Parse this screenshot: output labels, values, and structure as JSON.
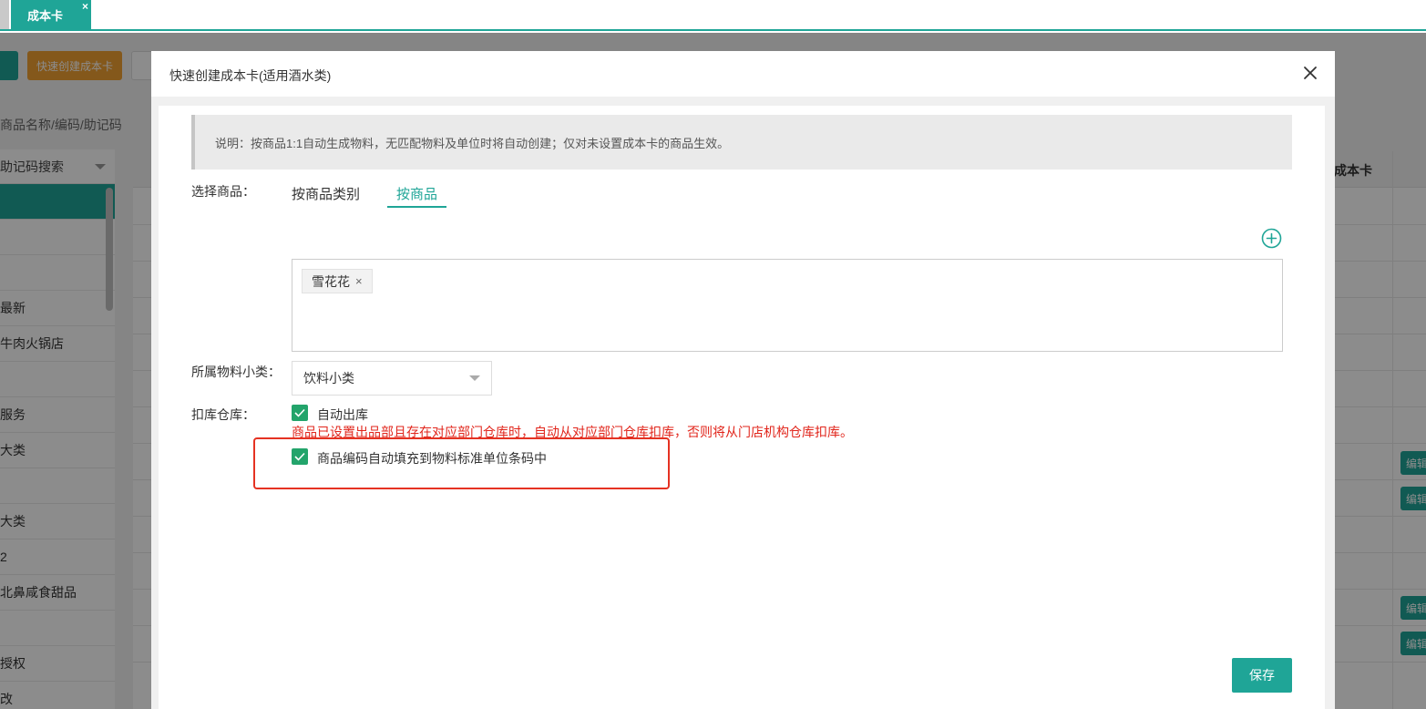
{
  "tabs": {
    "active_label": "成本卡",
    "close_glyph": "×"
  },
  "background": {
    "toolbar": {
      "quick_create_label": "快速创建成本卡"
    },
    "search_placeholder": "商品名称/编码/助记码",
    "sidebar_select": "助记码搜索",
    "sidebar_items": [
      "",
      "",
      "",
      "最新",
      "牛肉火锅店",
      "",
      "服务",
      "大类",
      "",
      "大类",
      "2",
      "北鼻咸食甜品",
      "",
      "授权",
      "改"
    ],
    "table": {
      "header_cost_card": "成本卡",
      "edit_label": "编辑"
    }
  },
  "modal": {
    "title": "快速创建成本卡(适用酒水类)",
    "close_icon": "close-icon",
    "notice": "说明：按商品1:1自动生成物料，无匹配物料及单位时将自动创建；仅对未设置成本卡的商品生效。",
    "select_goods_label": "选择商品：",
    "tabs": [
      {
        "label": "按商品类别",
        "active": false
      },
      {
        "label": "按商品",
        "active": true
      }
    ],
    "add_icon": "plus-circle-icon",
    "selected_tags": [
      {
        "label": "雪花花",
        "remove_glyph": "×"
      }
    ],
    "material_category": {
      "label": "所属物料小类：",
      "value": "饮料小类"
    },
    "warehouse": {
      "label": "扣库仓库：",
      "auto_out": {
        "label": "自动出库",
        "checked": true
      },
      "note": "商品已设置出品部且存在对应部门仓库时，自动从对应部门仓库扣库，否则将从门店机构仓库扣库。"
    },
    "barcode_fill": {
      "label": "商品编码自动填充到物料标准单位条码中",
      "checked": true
    },
    "save_label": "保存"
  },
  "colors": {
    "primary": "#1fa597",
    "checkbox": "#23a46b",
    "warning_text": "#e1251b",
    "highlight_border": "#e53222",
    "orange_button": "#f0a032"
  }
}
